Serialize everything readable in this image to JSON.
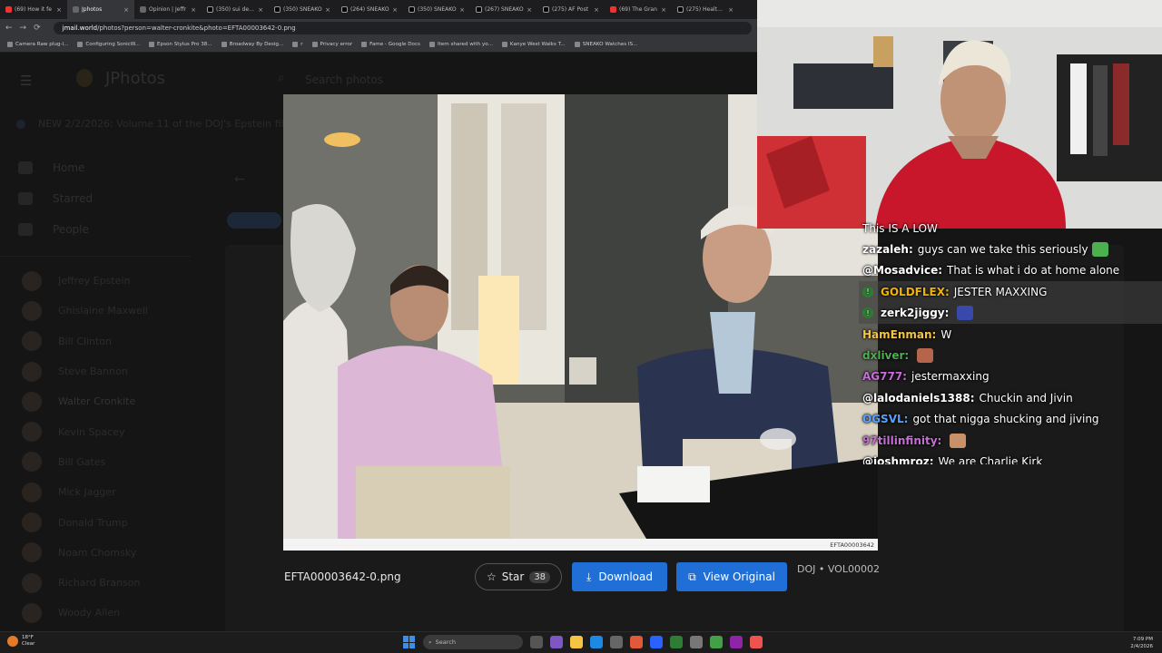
{
  "browser": {
    "tabs": [
      {
        "label": "(69) How it fe",
        "icon": "youtube-icon",
        "active": false
      },
      {
        "label": "Jphotos",
        "icon": "page-icon",
        "active": true
      },
      {
        "label": "Opinion | Jeffr",
        "icon": "page-icon",
        "active": false
      },
      {
        "label": "(350) sui dev @",
        "icon": "x-icon",
        "active": false
      },
      {
        "label": "(350) SNEAKO",
        "icon": "x-icon",
        "active": false
      },
      {
        "label": "(264) SNEAKO",
        "icon": "x-icon",
        "active": false
      },
      {
        "label": "(350) SNEAKO",
        "icon": "x-icon",
        "active": false
      },
      {
        "label": "(267) SNEAKO",
        "icon": "x-icon",
        "active": false
      },
      {
        "label": "(275) AF Post",
        "icon": "x-icon",
        "active": false
      },
      {
        "label": "(69) The Gran",
        "icon": "youtube-icon",
        "active": false
      },
      {
        "label": "(275) Health &",
        "icon": "x-icon",
        "active": false
      }
    ],
    "close_glyph": "×",
    "url_domain": "jmail.world",
    "url_path": "/photos?person=walter-cronkite&photo=EFTA00003642-0.png",
    "bookmarks": [
      "Camera Raw plug-i...",
      "Configuring SonicW...",
      "Epson Stylus Pro 38...",
      "Broadway By Desig...",
      "r",
      "Privacy error",
      "Fame - Google Docs",
      "Item shared with yo...",
      "Kanye West Walks T...",
      "SNEAKO Watches IS..."
    ]
  },
  "page": {
    "logo": "JPhotos",
    "search_placeholder": "Search photos",
    "banner": "NEW 2/2/2026: Volume 11 of the DOJ's Epstein files",
    "nav": [
      "Home",
      "Starred",
      "People"
    ],
    "people": [
      "Jeffrey Epstein",
      "Ghislaine Maxwell",
      "Bill Clinton",
      "Steve Bannon",
      "Walter Cronkite",
      "Kevin Spacey",
      "Bill Gates",
      "Mick Jagger",
      "Donald Trump",
      "Noam Chomsky",
      "Richard Branson",
      "Woody Allen"
    ],
    "selected_person_index": 4
  },
  "lightbox": {
    "photo_caption": "EFTA00003642",
    "filename": "EFTA00003642-0.png",
    "star_label": "Star",
    "star_count": "38",
    "download_label": "Download",
    "original_label": "View Original",
    "source": "DOJ • VOL00002"
  },
  "chat": {
    "messages": [
      {
        "user": "",
        "text": "This IS A LOW",
        "color": "#ffffff",
        "highlight": false,
        "badge": false,
        "emote": null
      },
      {
        "user": "zazaleh:",
        "text": "guys can we take this seriously",
        "color": "#ffffff",
        "highlight": false,
        "badge": false,
        "emote": "#4caf50"
      },
      {
        "user": "@Mosadvice:",
        "text": "That is what i do at home alone",
        "color": "#ffffff",
        "highlight": false,
        "badge": false,
        "emote": null
      },
      {
        "user": "GOLDFLEX:",
        "text": "JESTER MAXXING",
        "color": "#f0b400",
        "highlight": true,
        "badge": true,
        "emote": null
      },
      {
        "user": "zerk2jiggy:",
        "text": "",
        "color": "#ffffff",
        "highlight": true,
        "badge": true,
        "emote": "#3949ab"
      },
      {
        "user": "HamEnman:",
        "text": "W",
        "color": "#f5c542",
        "highlight": false,
        "badge": false,
        "emote": null
      },
      {
        "user": "dxliver:",
        "text": "",
        "color": "#4caf50",
        "highlight": false,
        "badge": false,
        "emote": "#b5654a"
      },
      {
        "user": "AG777:",
        "text": "jestermaxxing",
        "color": "#c76dd6",
        "highlight": false,
        "badge": false,
        "emote": null
      },
      {
        "user": "@lalodaniels1388:",
        "text": "Chuckin and Jivin",
        "color": "#ffffff",
        "highlight": false,
        "badge": false,
        "emote": null
      },
      {
        "user": "OGSVL:",
        "text": "got that nigga shucking and jiving",
        "color": "#5aa0ff",
        "highlight": false,
        "badge": false,
        "emote": null
      },
      {
        "user": "97tillinfinity:",
        "text": "",
        "color": "#c76dd6",
        "highlight": false,
        "badge": false,
        "emote": "#c8916a"
      },
      {
        "user": "@joshmroz:",
        "text": "We are Charlie Kirk",
        "color": "#ffffff",
        "highlight": false,
        "badge": false,
        "emote": null
      }
    ]
  },
  "taskbar": {
    "temp": "18°F",
    "weather": "Clear",
    "search": "Search",
    "time": "7:09 PM",
    "date": "2/4/2026"
  }
}
